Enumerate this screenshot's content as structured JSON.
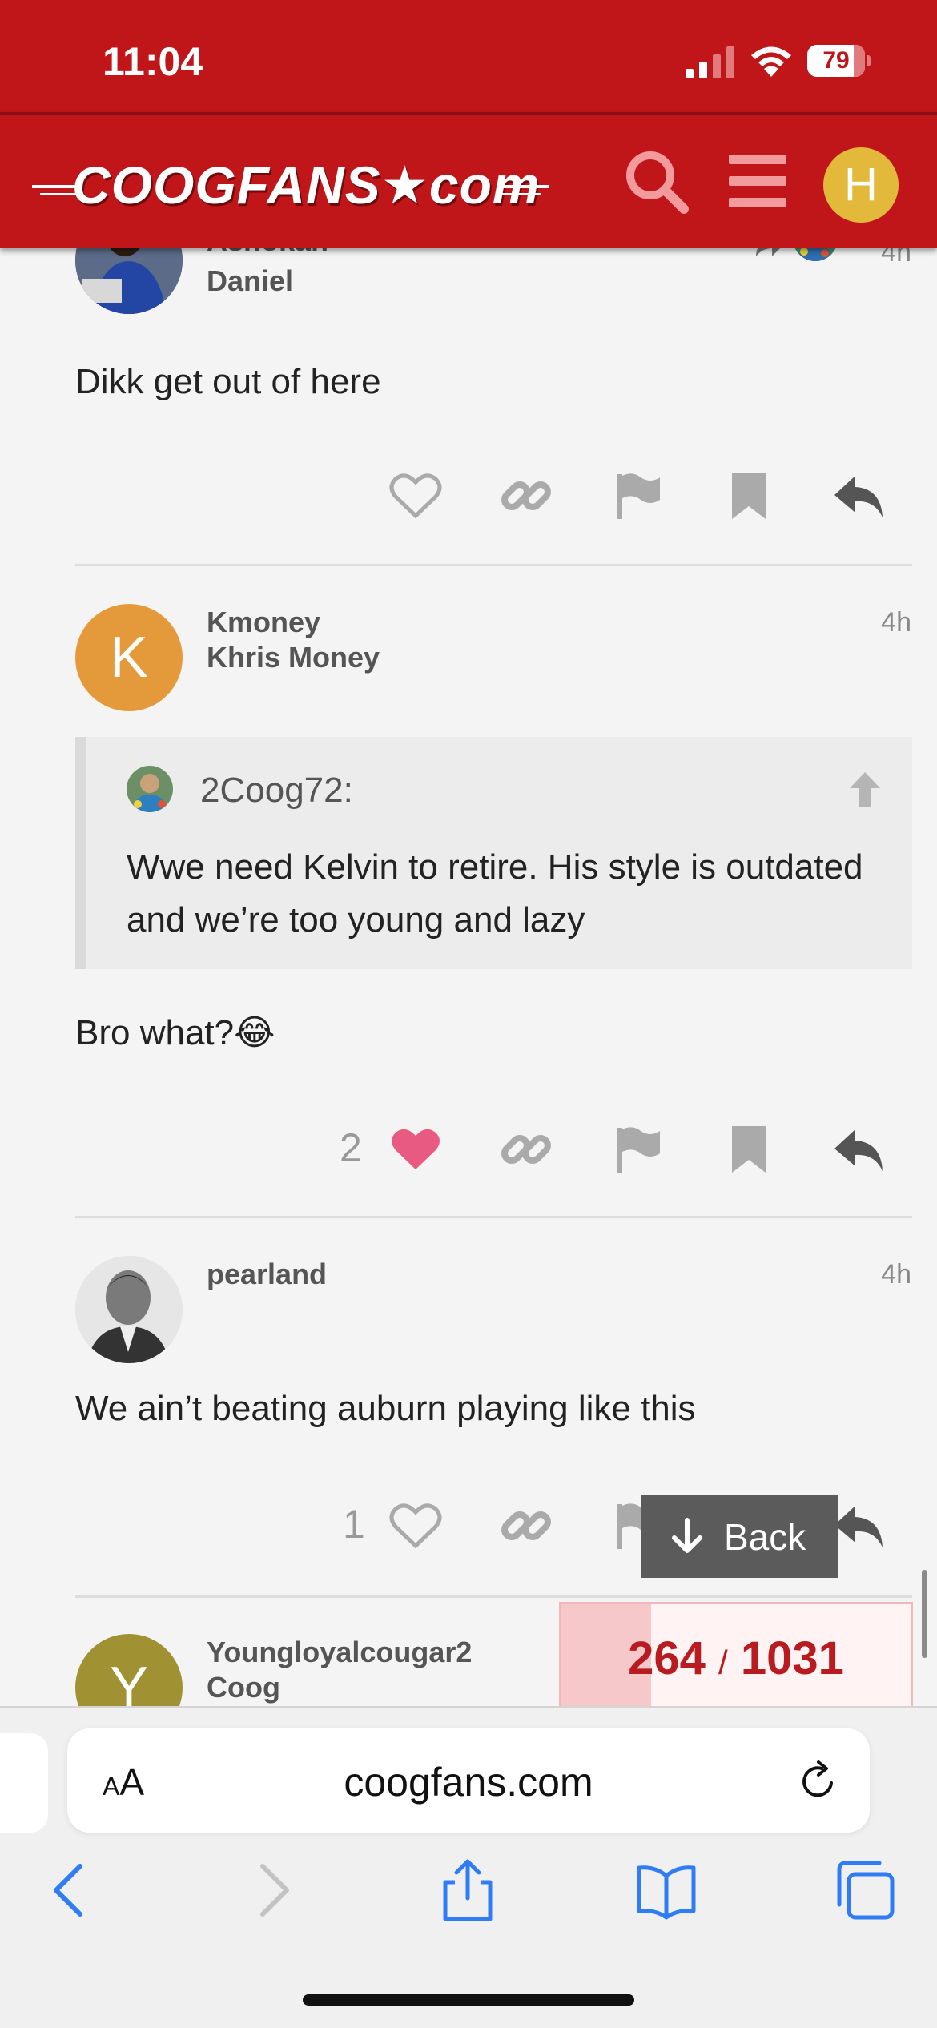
{
  "status_bar": {
    "time": "11:04",
    "battery": "79"
  },
  "header": {
    "logo_text": "COOGFANS★com",
    "avatar_letter": "H"
  },
  "posts": [
    {
      "username_top": "Ashokan",
      "username": "Daniel",
      "time": "4h",
      "body": "Dikk get out of here"
    },
    {
      "username": "Kmoney",
      "full_name": "Khris Money",
      "avatar_letter": "K",
      "time": "4h",
      "quote": {
        "user": "2Coog72:",
        "text": "Wwe need Kelvin to retire. His style is outdated and we’re too young and lazy"
      },
      "body": "Bro what?😂",
      "likes": "2"
    },
    {
      "username": "pearland",
      "time": "4h",
      "body": "We ain’t beating auburn playing like this",
      "likes": "1"
    },
    {
      "username": "Youngloyalcougar2",
      "full_name": "Coog",
      "avatar_letter": "Y"
    }
  ],
  "back_button": {
    "label": "Back"
  },
  "progress": {
    "current": "264",
    "separator": "/",
    "total": "1031"
  },
  "browser": {
    "url": "coogfans.com",
    "aa_label": "AA"
  },
  "colors": {
    "brand_red": "#c0161a",
    "heart_pink": "#e85a82",
    "avatar_k": "#e49a3b",
    "avatar_y": "#a09233",
    "avatar_h": "#e3b93b"
  }
}
